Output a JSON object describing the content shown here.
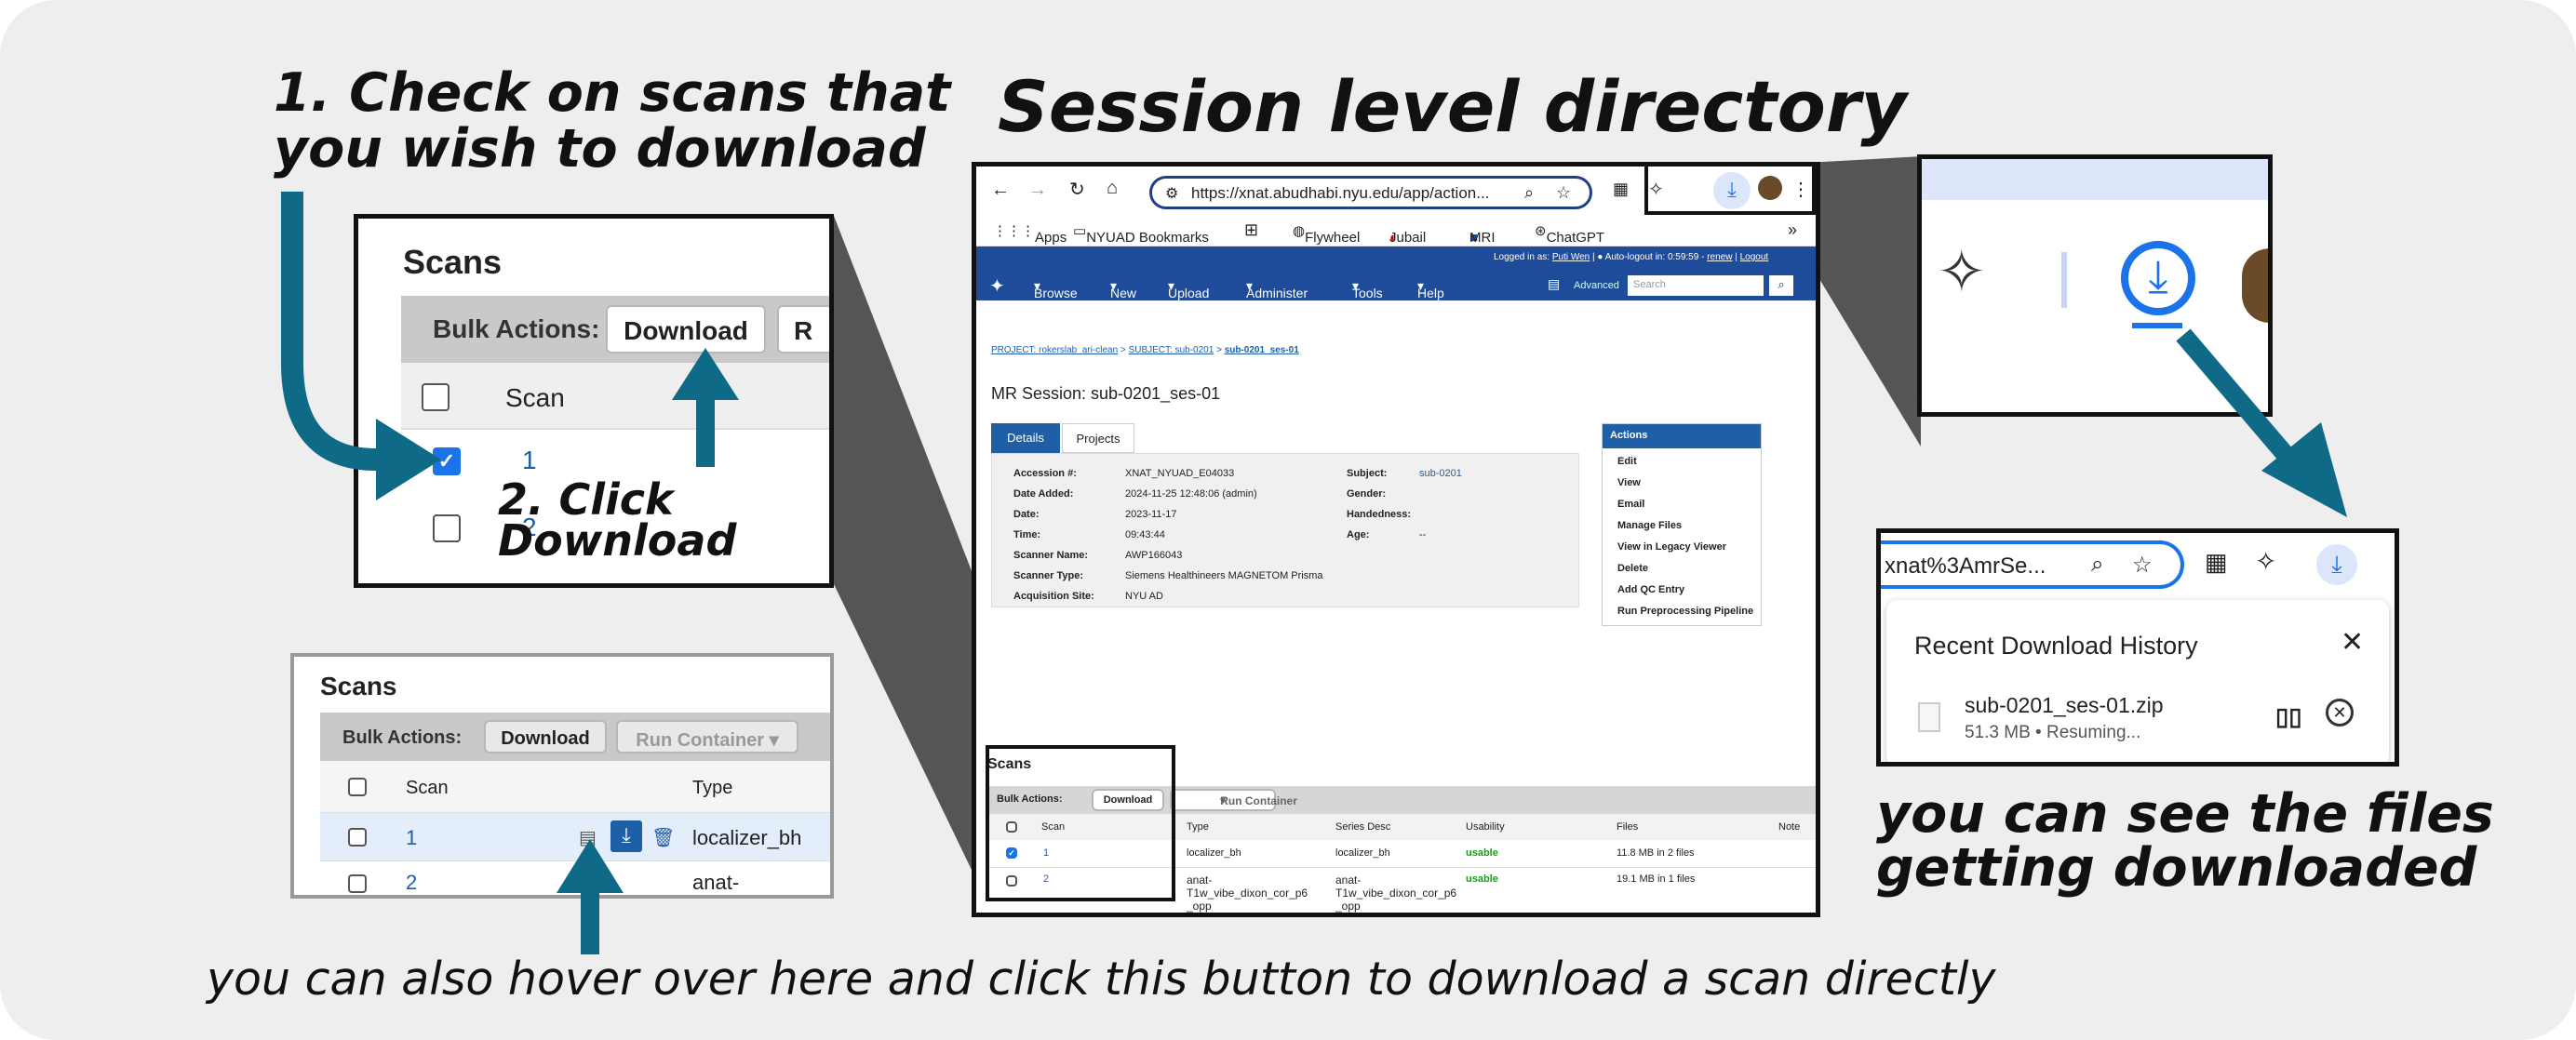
{
  "headings": {
    "step1_line1": "1. Check on scans that",
    "step1_line2": "you wish to download",
    "session_title": "Session level directory",
    "step2_line1": "2. Click",
    "step2_line2": "Download",
    "files_line1": "you can see the files",
    "files_line2": "getting downloaded",
    "hover_note": "you can also hover over here and click this button to download a scan directly"
  },
  "zoom_scans": {
    "title": "Scans",
    "bulk_label": "Bulk Actions:",
    "download": "Download",
    "run_partial": "R",
    "col_scan": "Scan",
    "rows": [
      {
        "id": "1",
        "checked": true
      },
      {
        "id": "2",
        "checked": false
      }
    ]
  },
  "small_scans": {
    "title": "Scans",
    "bulk_label": "Bulk Actions:",
    "download": "Download",
    "run_container": "Run Container",
    "col_scan": "Scan",
    "col_type": "Type",
    "rows": [
      {
        "id": "1",
        "type": "localizer_bh"
      },
      {
        "id": "2",
        "type": "anat-"
      }
    ]
  },
  "browser": {
    "url": "https://xnat.abudhabi.nyu.edu/app/action...",
    "bookmarks": [
      "Apps",
      "NYUAD Bookmarks",
      "Flywheel",
      "Jubail",
      "MRI",
      "ChatGPT"
    ],
    "logged_in": "Logged in as:",
    "user": "Puti Wen",
    "auto_logout": "Auto-logout in:",
    "timer": "0:59:59",
    "renew": "renew",
    "logout": "Logout",
    "nav": [
      "Browse",
      "New",
      "Upload",
      "Administer",
      "Tools",
      "Help"
    ],
    "advanced": "Advanced",
    "search_placeholder": "Search",
    "breadcrumb": {
      "project": "PROJECT: rokerslab_ari-clean",
      "subject": "SUBJECT: sub-0201",
      "session": "sub-0201_ses-01"
    },
    "session_heading": "MR Session: sub-0201_ses-01",
    "tabs": [
      "Details",
      "Projects"
    ],
    "details": [
      {
        "k": "Accession #:",
        "v": "XNAT_NYUAD_E04033"
      },
      {
        "k": "Date Added:",
        "v": "2024-11-25 12:48:06 (admin)"
      },
      {
        "k": "Date:",
        "v": "2023-11-17"
      },
      {
        "k": "Time:",
        "v": "09:43:44"
      },
      {
        "k": "Scanner Name:",
        "v": "AWP166043"
      },
      {
        "k": "Scanner Type:",
        "v": "Siemens Healthineers MAGNETOM Prisma"
      },
      {
        "k": "Acquisition Site:",
        "v": "NYU AD"
      }
    ],
    "details_right": [
      {
        "k": "Subject:",
        "v": "sub-0201"
      },
      {
        "k": "Gender:",
        "v": ""
      },
      {
        "k": "Handedness:",
        "v": ""
      },
      {
        "k": "Age:",
        "v": "--"
      }
    ],
    "actions_title": "Actions",
    "actions": [
      "Edit",
      "View",
      "Email",
      "Manage Files",
      "View in Legacy Viewer",
      "Delete",
      "Add QC Entry",
      "Run Preprocessing Pipeline"
    ],
    "scans_title": "Scans",
    "bulk_label": "Bulk Actions:",
    "download": "Download",
    "run_container": "Run Container",
    "cols": [
      "Scan",
      "Type",
      "Series Desc",
      "Usability",
      "Files",
      "Note"
    ],
    "rows": [
      {
        "id": "1",
        "type": "localizer_bh",
        "desc": "localizer_bh",
        "usability": "usable",
        "files": "11.8 MB in 2 files"
      },
      {
        "id": "2",
        "type": "anat-",
        "type2": "T1w_vibe_dixon_cor_p6",
        "type3": "_opp",
        "desc": "anat-",
        "desc2": "T1w_vibe_dixon_cor_p6",
        "desc3": "_opp",
        "usability": "usable",
        "files": "19.1 MB in 1 files"
      }
    ]
  },
  "downloads": {
    "url_fragment": "xnat%3AmrSe...",
    "history_title": "Recent Download History",
    "file_name": "sub-0201_ses-01.zip",
    "file_status": "51.3 MB • Resuming..."
  },
  "colors": {
    "arrow": "#0e6a86",
    "xnat_blue": "#1f4c9a",
    "chrome_blue": "#1a73e8"
  }
}
